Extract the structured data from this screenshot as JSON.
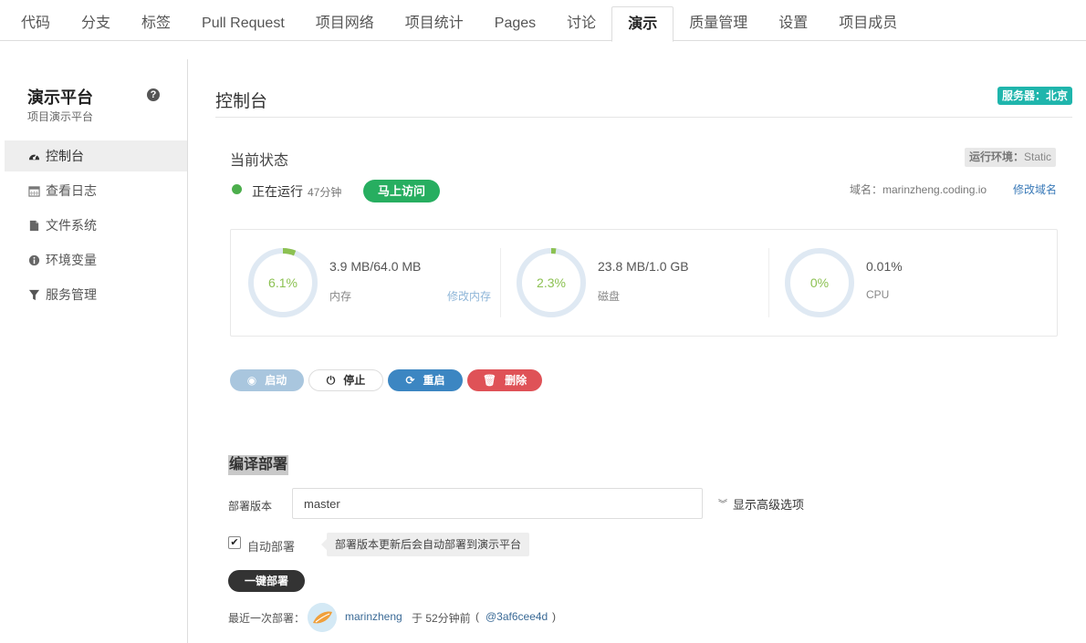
{
  "tabs": [
    {
      "label": "代码"
    },
    {
      "label": "分支"
    },
    {
      "label": "标签"
    },
    {
      "label": "Pull Request"
    },
    {
      "label": "项目网络"
    },
    {
      "label": "项目统计"
    },
    {
      "label": "Pages"
    },
    {
      "label": "讨论"
    },
    {
      "label": "演示",
      "active": true
    },
    {
      "label": "质量管理"
    },
    {
      "label": "设置"
    },
    {
      "label": "项目成员"
    }
  ],
  "sidebar": {
    "title": "演示平台",
    "subtitle": "项目演示平台",
    "help_icon": "question-circle-icon",
    "items": [
      {
        "label": "控制台",
        "icon": "dashboard-icon",
        "active": true
      },
      {
        "label": "查看日志",
        "icon": "calendar-icon"
      },
      {
        "label": "文件系统",
        "icon": "file-icon"
      },
      {
        "label": "环境变量",
        "icon": "info-circle-icon"
      },
      {
        "label": "服务管理",
        "icon": "filter-icon"
      }
    ]
  },
  "header": {
    "title": "控制台",
    "server_badge": "服务器：北京"
  },
  "status": {
    "title": "当前状态",
    "env_label": "运行环境：",
    "env_value": "Static",
    "state": "正在运行",
    "uptime": "47分钟",
    "visit_label": "马上访问",
    "domain_label": "域名：marinzheng.coding.io",
    "edit_domain_label": "修改域名"
  },
  "stats": [
    {
      "percent": "6.1%",
      "fraction": 0.061,
      "value": "3.9 MB/64.0 MB",
      "label": "内存",
      "action": "修改内存"
    },
    {
      "percent": "2.3%",
      "fraction": 0.023,
      "value": "23.8 MB/1.0 GB",
      "label": "磁盘"
    },
    {
      "percent": "0%",
      "fraction": 0,
      "value": "0.01%",
      "label": "CPU"
    }
  ],
  "actions": {
    "start": "启动",
    "stop": "停止",
    "restart": "重启",
    "delete": "删除"
  },
  "deploy": {
    "title": "编译部署",
    "version_label": "部署版本",
    "version_value": "master",
    "advanced_label": "显示高级选项",
    "auto_label": "自动部署",
    "auto_checked": true,
    "auto_tip": "部署版本更新后会自动部署到演示平台",
    "deploy_button": "一键部署",
    "last_label": "最近一次部署：",
    "last_user": "marinzheng",
    "last_time": "于 52分钟前",
    "last_hash": "@3af6cee4d"
  },
  "colors": {
    "accent_teal": "#1fb5ac",
    "running_green": "#4cae4c",
    "ring_green": "#8cc152",
    "ring_track": "#dfe9f3",
    "start_blue_light": "#a9c6de",
    "restart_blue": "#3c86c2",
    "delete_red": "#df5257",
    "link_blue": "#3a7ab8"
  }
}
